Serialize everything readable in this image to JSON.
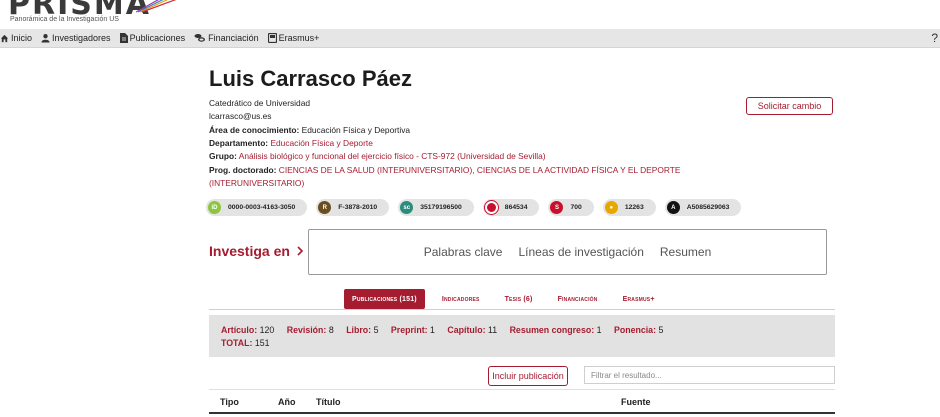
{
  "logo": {
    "word": "PRISMA",
    "subtitle": "Panorámica de la Investigación US"
  },
  "nav": {
    "items": [
      {
        "label": "Inicio",
        "icon": "home-icon"
      },
      {
        "label": "Investigadores",
        "icon": "person-icon"
      },
      {
        "label": "Publicaciones",
        "icon": "document-icon"
      },
      {
        "label": "Financiación",
        "icon": "coins-icon"
      },
      {
        "label": "Erasmus+",
        "icon": "book-icon"
      }
    ],
    "help": "?"
  },
  "profile": {
    "name": "Luis Carrasco Páez",
    "position": "Catedrático de Universidad",
    "email": "lcarrasco@us.es",
    "area_label": "Área de conocimiento:",
    "area_value": "Educación Física y Deportiva",
    "dept_label": "Departamento:",
    "dept_value": "Educación Física y Deporte",
    "group_label": "Grupo:",
    "group_value": "Análisis biológico y funcional del ejercicio físico - CTS-972 (Universidad de Sevilla)",
    "prog_label": "Prog. doctorado:",
    "prog_value_line1": "CIENCIAS DE LA SALUD (INTERUNIVERSITARIO), CIENCIAS DE LA ACTIVIDAD FÍSICA Y EL DEPORTE",
    "prog_value_line2": "(INTERUNIVERSITARIO)",
    "change_button": "Solicitar cambio"
  },
  "identifiers": [
    {
      "value": "0000-0003-4163-3050",
      "icon": "orcid-icon",
      "color": "#8cc63f"
    },
    {
      "value": "F-3878-2010",
      "icon": "researcherid-icon",
      "color": "#6b4e1f"
    },
    {
      "value": "35179196500",
      "icon": "scopus-icon",
      "color": "#2a8c7a"
    },
    {
      "value": "864534",
      "icon": "dialnet-icon",
      "color": "#c8102e"
    },
    {
      "value": "700",
      "icon": "sisius-icon",
      "color": "#c8102e"
    },
    {
      "value": "12263",
      "icon": "researcher-user-icon",
      "color": "#e6a800"
    },
    {
      "value": "A5085629063",
      "icon": "openalex-icon",
      "color": "#111111"
    }
  ],
  "investiga": {
    "label": "Investiga en",
    "links": [
      "Palabras clave",
      "Líneas de investigación",
      "Resumen"
    ]
  },
  "tabs": [
    {
      "label": "Publicaciones (151)",
      "active": true
    },
    {
      "label": "Indicadores",
      "active": false
    },
    {
      "label": "Tesis (6)",
      "active": false
    },
    {
      "label": "Financiación",
      "active": false
    },
    {
      "label": "Erasmus+",
      "active": false
    }
  ],
  "summary": {
    "items": [
      {
        "key": "Artículo:",
        "value": "120"
      },
      {
        "key": "Revisión:",
        "value": "8"
      },
      {
        "key": "Libro:",
        "value": "5"
      },
      {
        "key": "Preprint:",
        "value": "1"
      },
      {
        "key": "Capítulo:",
        "value": "11"
      },
      {
        "key": "Resumen congreso:",
        "value": "1"
      },
      {
        "key": "Ponencia:",
        "value": "5"
      }
    ],
    "total_label": "TOTAL:",
    "total_value": "151"
  },
  "actions": {
    "include_button": "Incluir publicación",
    "filter_placeholder": "Filtrar el resultado..."
  },
  "table": {
    "columns": [
      "Tipo",
      "Año",
      "Título",
      "Fuente"
    ]
  },
  "colors": {
    "accent": "#a51c30",
    "nav_bg": "#e6e6e6",
    "summary_bg": "#e2e2e2"
  }
}
